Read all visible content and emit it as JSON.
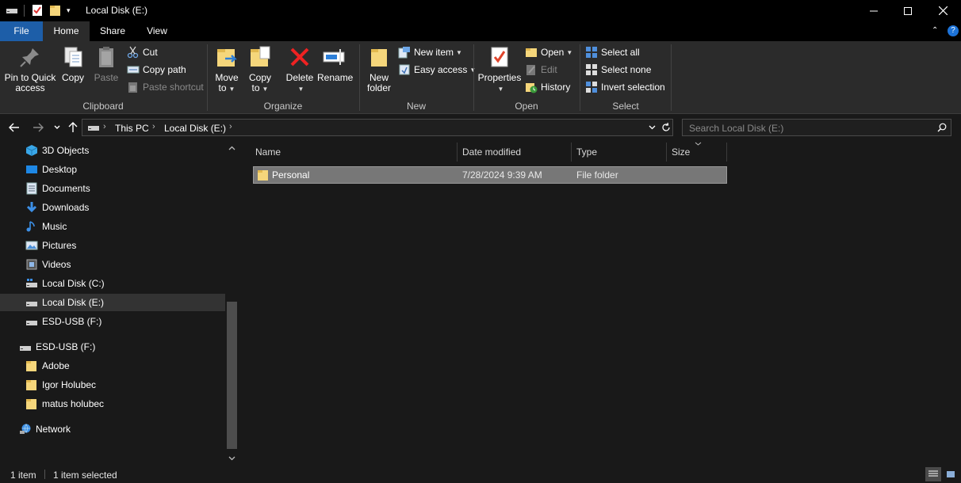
{
  "window": {
    "title": "Local Disk (E:)"
  },
  "ribbon_tabs": [
    "File",
    "Home",
    "Share",
    "View"
  ],
  "ribbon": {
    "clipboard": {
      "label": "Clipboard",
      "pin": "Pin to Quick access",
      "pin_line1": "Pin to Quick",
      "pin_line2": "access",
      "copy": "Copy",
      "paste": "Paste",
      "cut": "Cut",
      "copy_path": "Copy path",
      "paste_shortcut": "Paste shortcut"
    },
    "organize": {
      "label": "Organize",
      "move_to_line1": "Move",
      "move_to_line2": "to",
      "copy_to_line1": "Copy",
      "copy_to_line2": "to",
      "delete": "Delete",
      "rename": "Rename"
    },
    "new": {
      "label": "New",
      "new_folder_line1": "New",
      "new_folder_line2": "folder",
      "new_item": "New item",
      "easy_access": "Easy access"
    },
    "open": {
      "label": "Open",
      "properties": "Properties",
      "open": "Open",
      "edit": "Edit",
      "history": "History"
    },
    "select": {
      "label": "Select",
      "select_all": "Select all",
      "select_none": "Select none",
      "invert_selection": "Invert selection"
    }
  },
  "address": {
    "crumbs": [
      "This PC",
      "Local Disk (E:)"
    ],
    "search_placeholder": "Search Local Disk (E:)"
  },
  "nav_pane": {
    "items": [
      {
        "label": "3D Objects",
        "icon": "3d-objects-icon"
      },
      {
        "label": "Desktop",
        "icon": "desktop-icon"
      },
      {
        "label": "Documents",
        "icon": "documents-icon"
      },
      {
        "label": "Downloads",
        "icon": "downloads-icon"
      },
      {
        "label": "Music",
        "icon": "music-icon"
      },
      {
        "label": "Pictures",
        "icon": "pictures-icon"
      },
      {
        "label": "Videos",
        "icon": "videos-icon"
      },
      {
        "label": "Local Disk (C:)",
        "icon": "drive-icon"
      },
      {
        "label": "Local Disk (E:)",
        "icon": "drive-icon",
        "selected": true
      },
      {
        "label": "ESD-USB (F:)",
        "icon": "usb-drive-icon"
      },
      {
        "label": "ESD-USB (F:)",
        "icon": "usb-drive-icon"
      },
      {
        "label": "Adobe",
        "icon": "folder-icon"
      },
      {
        "label": "Igor Holubec",
        "icon": "folder-icon"
      },
      {
        "label": "matus holubec",
        "icon": "folder-icon"
      },
      {
        "label": "Network",
        "icon": "network-icon"
      }
    ]
  },
  "file_list": {
    "columns": [
      "Name",
      "Date modified",
      "Type",
      "Size"
    ],
    "rows": [
      {
        "name": "Personal",
        "date_modified": "7/28/2024 9:39 AM",
        "type": "File folder",
        "size": ""
      }
    ]
  },
  "status": {
    "item_count": "1 item",
    "selection": "1 item selected"
  },
  "colors": {
    "accent_file_tab": "#1d5ea8",
    "selection_row": "#777777",
    "background": "#191919",
    "folder_yellow": "#f5d67b"
  }
}
